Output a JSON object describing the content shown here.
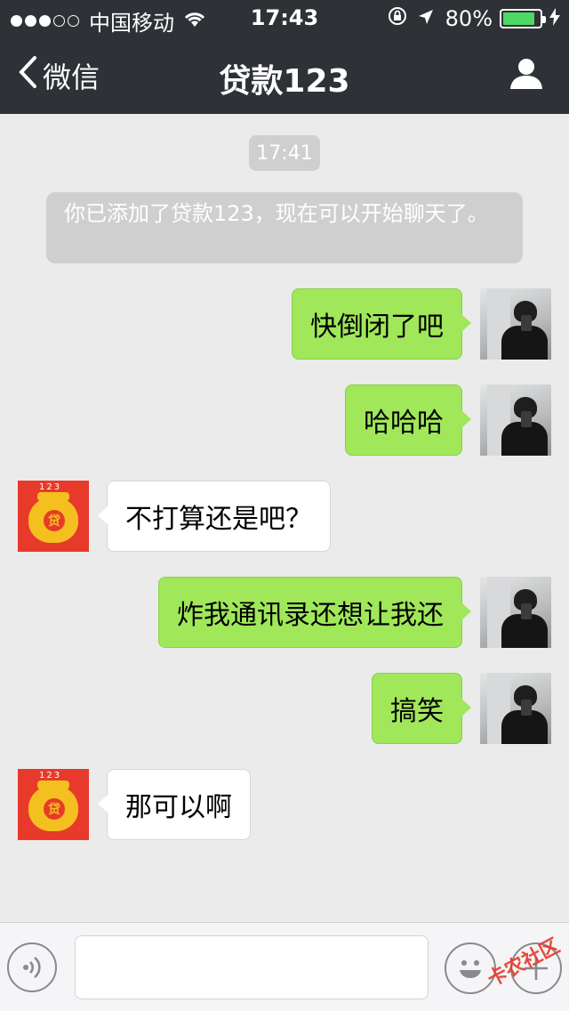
{
  "status_bar": {
    "signal_dots_full": 3,
    "signal_dots_empty": 2,
    "carrier": "中国移动",
    "time": "17:43",
    "battery_percent": "80%",
    "battery_level": 0.8,
    "icons": [
      "wifi-icon",
      "orientation-lock-icon",
      "location-arrow-icon",
      "battery-icon",
      "charging-bolt-icon"
    ]
  },
  "nav": {
    "back_label": "微信",
    "title": "贷款123",
    "profile_icon": "person-icon",
    "bar_color": "#2e3135"
  },
  "chat": {
    "timestamp": "17:41",
    "system_message": "你已添加了贷款123，现在可以开始聊天了。",
    "messages": [
      {
        "sender": "me",
        "text": "快倒闭了吧"
      },
      {
        "sender": "me",
        "text": "哈哈哈"
      },
      {
        "sender": "contact",
        "text": "不打算还是吧？"
      },
      {
        "sender": "me",
        "text": "炸我通讯录还想让我还"
      },
      {
        "sender": "me",
        "text": "搞笑"
      },
      {
        "sender": "contact",
        "text": "那可以啊"
      }
    ],
    "contact_avatar_text": "贷",
    "contact_avatar_numbers": "123",
    "my_bubble_color": "#a0e75a",
    "contact_bubble_color": "#ffffff"
  },
  "input_bar": {
    "voice_icon": "voice-icon",
    "emoji_icon": "emoji-icon",
    "plus_icon": "plus-icon",
    "input_value": ""
  },
  "watermark": {
    "text": "卡农社区"
  }
}
